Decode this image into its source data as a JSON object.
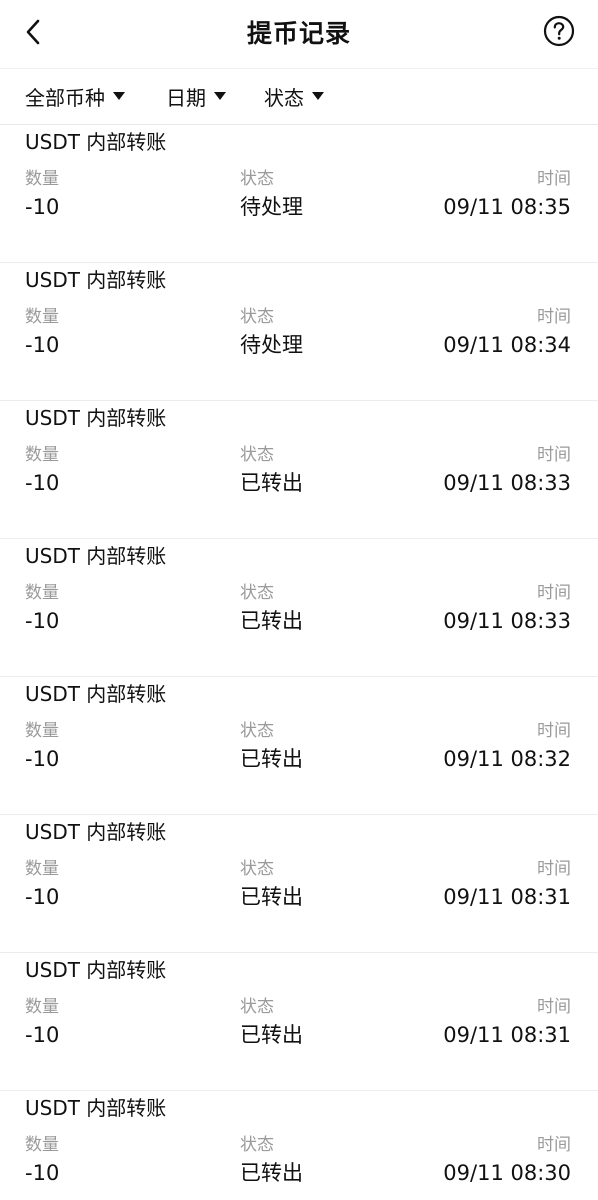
{
  "header": {
    "title": "提币记录",
    "back_icon": "chevron-left-icon",
    "help_icon": "question-circle-icon"
  },
  "filters": [
    {
      "label": "全部币种"
    },
    {
      "label": "日期"
    },
    {
      "label": "状态"
    }
  ],
  "column_labels": {
    "amount": "数量",
    "status": "状态",
    "time": "时间"
  },
  "records": [
    {
      "title": "USDT 内部转账",
      "amount": "-10",
      "status": "待处理",
      "time": "09/11 08:35"
    },
    {
      "title": "USDT 内部转账",
      "amount": "-10",
      "status": "待处理",
      "time": "09/11 08:34"
    },
    {
      "title": "USDT 内部转账",
      "amount": "-10",
      "status": "已转出",
      "time": "09/11 08:33"
    },
    {
      "title": "USDT 内部转账",
      "amount": "-10",
      "status": "已转出",
      "time": "09/11 08:33"
    },
    {
      "title": "USDT 内部转账",
      "amount": "-10",
      "status": "已转出",
      "time": "09/11 08:32"
    },
    {
      "title": "USDT 内部转账",
      "amount": "-10",
      "status": "已转出",
      "time": "09/11 08:31"
    },
    {
      "title": "USDT 内部转账",
      "amount": "-10",
      "status": "已转出",
      "time": "09/11 08:31"
    },
    {
      "title": "USDT 内部转账",
      "amount": "-10",
      "status": "已转出",
      "time": "09/11 08:30"
    }
  ]
}
